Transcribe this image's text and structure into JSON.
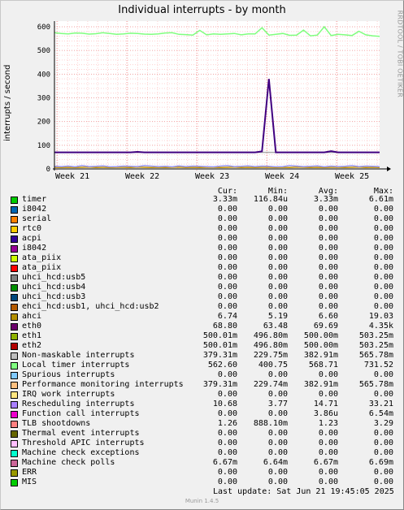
{
  "header": {
    "title": "Individual interrupts - by month",
    "side_label": "RRDTOOL / TOBI OETIKER",
    "version": "Munin 1.4.5"
  },
  "chart_data": {
    "type": "line",
    "title": "Individual interrupts - by month",
    "ylabel": "interrupts / second",
    "ylim": [
      0,
      600
    ],
    "yticks": [
      0,
      100,
      200,
      300,
      400,
      500,
      600
    ],
    "xticks": [
      "Week 21",
      "Week 22",
      "Week 23",
      "Week 24",
      "Week 25"
    ],
    "grid": true,
    "series": [
      {
        "name": "Local timer interrupts",
        "color": "#7fff7f",
        "values": [
          575,
          572,
          570,
          574,
          573,
          569,
          571,
          575,
          572,
          568,
          570,
          573,
          572,
          569,
          568,
          570,
          574,
          575,
          568,
          567,
          565,
          585,
          566,
          570,
          568,
          570,
          572,
          566,
          570,
          570,
          596,
          565,
          568,
          572,
          564,
          565,
          586,
          562,
          565,
          600,
          563,
          568,
          566,
          563,
          581,
          566,
          562,
          560
        ]
      },
      {
        "name": "Performance monitoring interrupts",
        "color": "#400080",
        "values": [
          70,
          70,
          70,
          70,
          70,
          70,
          70,
          70,
          70,
          70,
          70,
          70,
          72,
          70,
          70,
          70,
          70,
          70,
          70,
          70,
          70,
          70,
          70,
          70,
          70,
          70,
          70,
          70,
          70,
          70,
          74,
          380,
          70,
          70,
          70,
          70,
          70,
          70,
          70,
          70,
          75,
          70,
          70,
          70,
          70,
          70,
          70,
          70
        ]
      },
      {
        "name": "Non-maskable interrupts",
        "color": "#aaaaaa",
        "values": [
          70,
          70,
          70,
          70,
          70,
          70,
          70,
          70,
          70,
          70,
          70,
          70,
          70,
          70,
          70,
          70,
          70,
          70,
          70,
          70,
          70,
          70,
          70,
          70,
          70,
          70,
          70,
          70,
          70,
          70,
          70,
          70,
          70,
          70,
          70,
          70,
          70,
          70,
          70,
          70,
          70,
          70,
          70,
          70,
          70,
          70,
          70,
          70
        ]
      },
      {
        "name": "Rescheduling interrupts",
        "color": "#9999ff",
        "values": [
          11,
          10,
          12,
          9,
          14,
          10,
          11,
          13,
          9,
          10,
          12,
          11,
          10,
          14,
          12,
          10,
          11,
          9,
          13,
          10,
          12,
          11,
          10,
          9,
          12,
          14,
          10,
          11,
          13,
          10,
          12,
          11,
          9,
          10,
          14,
          12,
          10,
          11,
          13,
          9,
          12,
          10,
          11,
          14,
          10,
          12,
          11,
          10
        ]
      },
      {
        "name": "ahci",
        "color": "#c09000",
        "values": [
          7,
          6,
          7,
          6,
          7,
          8,
          6,
          7,
          6,
          7,
          7,
          6,
          8,
          7,
          6,
          7,
          6,
          7,
          8,
          6,
          7,
          6,
          7,
          7,
          6,
          7,
          8,
          6,
          7,
          6,
          7,
          7,
          6,
          7,
          6,
          8,
          7,
          6,
          7,
          6,
          7,
          7,
          6,
          7,
          8,
          6,
          7,
          6
        ]
      }
    ]
  },
  "legend": {
    "columns": [
      "Cur:",
      "Min:",
      "Avg:",
      "Max:"
    ],
    "rows": [
      {
        "name": "timer",
        "color": "#00cc00",
        "cur": "3.33m",
        "min": "116.84u",
        "avg": "3.33m",
        "max": "6.61m"
      },
      {
        "name": "i8042",
        "color": "#0066b3",
        "cur": "0.00",
        "min": "0.00",
        "avg": "0.00",
        "max": "0.00"
      },
      {
        "name": "serial",
        "color": "#ff8000",
        "cur": "0.00",
        "min": "0.00",
        "avg": "0.00",
        "max": "0.00"
      },
      {
        "name": "rtc0",
        "color": "#ffcc00",
        "cur": "0.00",
        "min": "0.00",
        "avg": "0.00",
        "max": "0.00"
      },
      {
        "name": "acpi",
        "color": "#330099",
        "cur": "0.00",
        "min": "0.00",
        "avg": "0.00",
        "max": "0.00"
      },
      {
        "name": "i8042",
        "color": "#990099",
        "cur": "0.00",
        "min": "0.00",
        "avg": "0.00",
        "max": "0.00"
      },
      {
        "name": "ata_piix",
        "color": "#ccff00",
        "cur": "0.00",
        "min": "0.00",
        "avg": "0.00",
        "max": "0.00"
      },
      {
        "name": "ata_piix",
        "color": "#ff0000",
        "cur": "0.00",
        "min": "0.00",
        "avg": "0.00",
        "max": "0.00"
      },
      {
        "name": "uhci_hcd:usb5",
        "color": "#808080",
        "cur": "0.00",
        "min": "0.00",
        "avg": "0.00",
        "max": "0.00"
      },
      {
        "name": "uhci_hcd:usb4",
        "color": "#008f00",
        "cur": "0.00",
        "min": "0.00",
        "avg": "0.00",
        "max": "0.00"
      },
      {
        "name": "uhci_hcd:usb3",
        "color": "#00487d",
        "cur": "0.00",
        "min": "0.00",
        "avg": "0.00",
        "max": "0.00"
      },
      {
        "name": "ehci_hcd:usb1, uhci_hcd:usb2",
        "color": "#b35a00",
        "cur": "0.00",
        "min": "0.00",
        "avg": "0.00",
        "max": "0.00"
      },
      {
        "name": "ahci",
        "color": "#b38f00",
        "cur": "6.74",
        "min": "5.19",
        "avg": "6.60",
        "max": "19.03"
      },
      {
        "name": "eth0",
        "color": "#6b006b",
        "cur": "68.80",
        "min": "63.48",
        "avg": "69.69",
        "max": "4.35k"
      },
      {
        "name": "eth1",
        "color": "#8fb300",
        "cur": "500.01m",
        "min": "496.80m",
        "avg": "500.00m",
        "max": "503.25m"
      },
      {
        "name": "eth2",
        "color": "#b30000",
        "cur": "500.01m",
        "min": "496.80m",
        "avg": "500.00m",
        "max": "503.25m"
      },
      {
        "name": "Non-maskable interrupts",
        "color": "#bebebe",
        "cur": "379.31m",
        "min": "229.75m",
        "avg": "382.91m",
        "max": "565.78m"
      },
      {
        "name": "Local timer interrupts",
        "color": "#80ff80",
        "cur": "562.60",
        "min": "400.75",
        "avg": "568.71",
        "max": "731.52"
      },
      {
        "name": "Spurious interrupts",
        "color": "#80c9ff",
        "cur": "0.00",
        "min": "0.00",
        "avg": "0.00",
        "max": "0.00"
      },
      {
        "name": "Performance monitoring interrupts",
        "color": "#ffc080",
        "cur": "379.31m",
        "min": "229.74m",
        "avg": "382.91m",
        "max": "565.78m"
      },
      {
        "name": "IRQ work interrupts",
        "color": "#ffe680",
        "cur": "0.00",
        "min": "0.00",
        "avg": "0.00",
        "max": "0.00"
      },
      {
        "name": "Rescheduling interrupts",
        "color": "#aa80ff",
        "cur": "10.68",
        "min": "3.77",
        "avg": "14.71",
        "max": "33.21"
      },
      {
        "name": "Function call interrupts",
        "color": "#ee00cc",
        "cur": "0.00",
        "min": "0.00",
        "avg": "3.86u",
        "max": "6.54m"
      },
      {
        "name": "TLB shootdowns",
        "color": "#ff8080",
        "cur": "1.26",
        "min": "888.10m",
        "avg": "1.23",
        "max": "3.29"
      },
      {
        "name": "Thermal event interrupts",
        "color": "#666600",
        "cur": "0.00",
        "min": "0.00",
        "avg": "0.00",
        "max": "0.00"
      },
      {
        "name": "Threshold APIC interrupts",
        "color": "#ffbfff",
        "cur": "0.00",
        "min": "0.00",
        "avg": "0.00",
        "max": "0.00"
      },
      {
        "name": "Machine check exceptions",
        "color": "#00ffcc",
        "cur": "0.00",
        "min": "0.00",
        "avg": "0.00",
        "max": "0.00"
      },
      {
        "name": "Machine check polls",
        "color": "#cc6699",
        "cur": "6.67m",
        "min": "6.64m",
        "avg": "6.67m",
        "max": "6.69m"
      },
      {
        "name": "ERR",
        "color": "#999900",
        "cur": "0.00",
        "min": "0.00",
        "avg": "0.00",
        "max": "0.00"
      },
      {
        "name": "MIS",
        "color": "#00cc00",
        "cur": "0.00",
        "min": "0.00",
        "avg": "0.00",
        "max": "0.00"
      }
    ]
  },
  "footer": {
    "last_update": "Last update:  Sat Jun 21 19:45:05 2025"
  }
}
